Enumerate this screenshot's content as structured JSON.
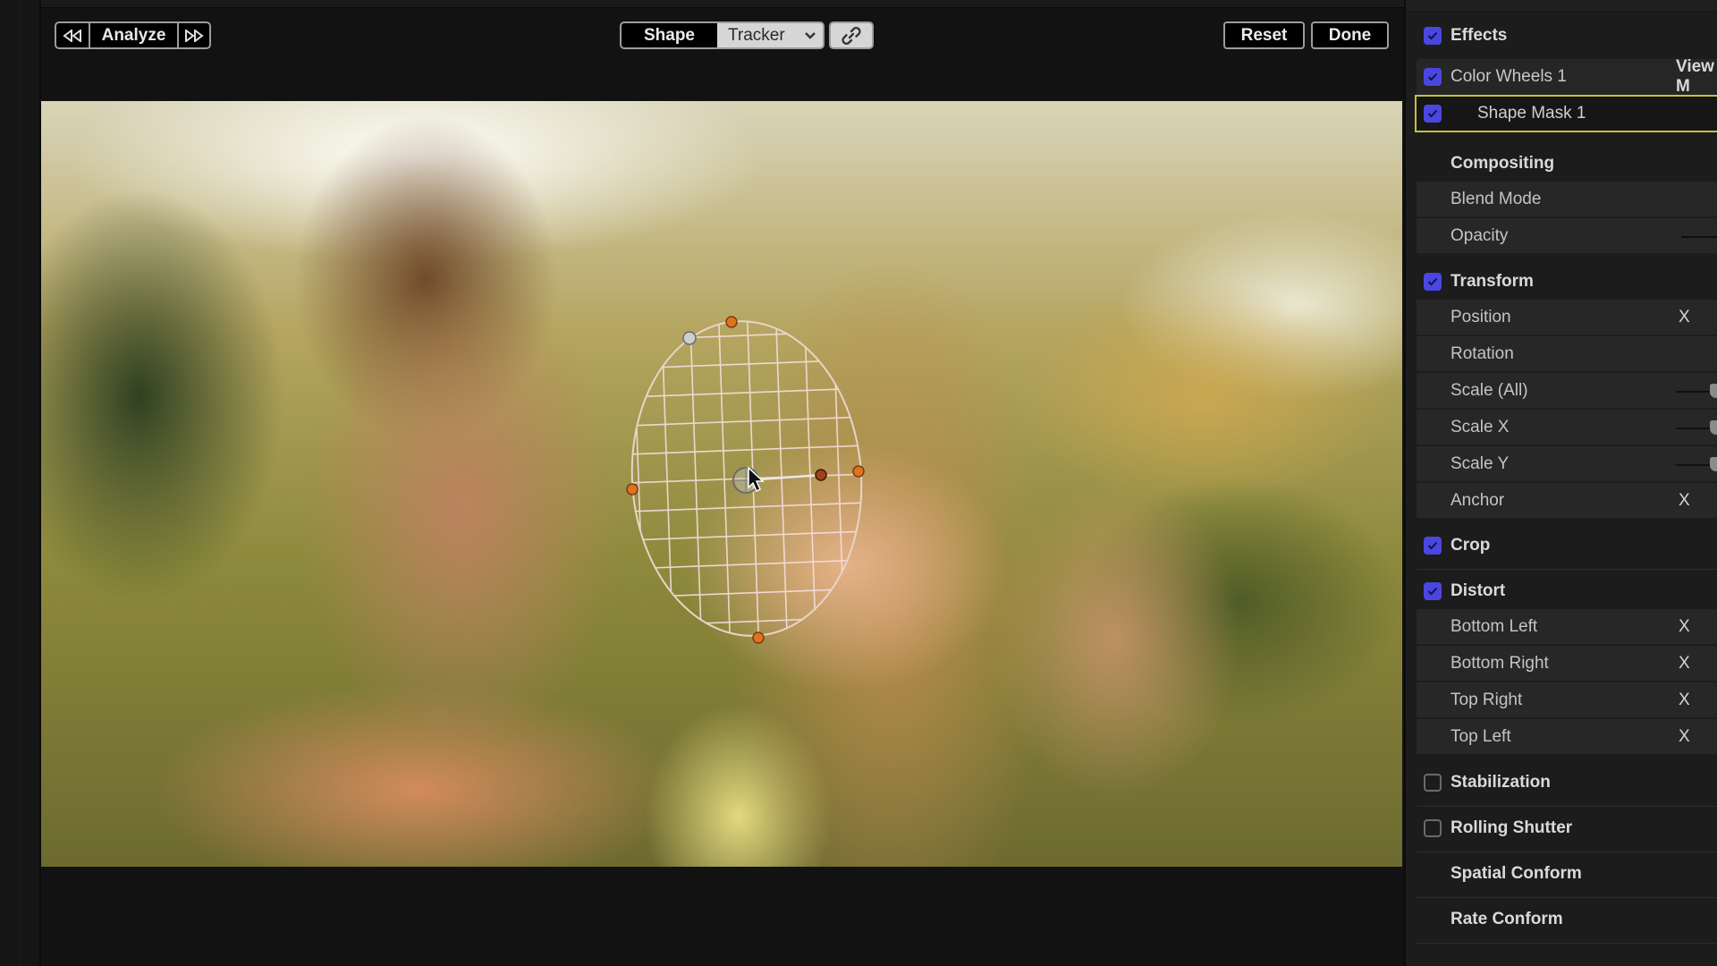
{
  "viewer": {
    "toolbar": {
      "prev_icon": "rewind-icon",
      "analyze_label": "Analyze",
      "next_icon": "fast-forward-icon",
      "shape_label": "Shape",
      "tracker_label": "Tracker",
      "tracker_chevron_icon": "chevron-down-icon",
      "link_icon": "link-icon",
      "reset_label": "Reset",
      "done_label": "Done"
    },
    "image_description": "Couple smiling outdoors in sunlight; shape mask ellipse with grid over woman's face",
    "mask": {
      "shape": "ellipse",
      "handles": [
        "top",
        "left",
        "right",
        "bottom",
        "roundness",
        "rotation",
        "center"
      ],
      "handle_color": "#e0731f",
      "grid_color": "#f4d9d9"
    }
  },
  "inspector": {
    "effects": {
      "label": "Effects",
      "checked": true
    },
    "color_wheels": {
      "label": "Color Wheels 1",
      "checked": true,
      "view_label": "View M"
    },
    "shape_mask": {
      "label": "Shape Mask 1",
      "checked": true,
      "highlight_color": "#c6c33a"
    },
    "compositing": {
      "label": "Compositing",
      "items": [
        {
          "label": "Blend Mode"
        },
        {
          "label": "Opacity"
        }
      ]
    },
    "transform": {
      "label": "Transform",
      "checked": true,
      "items": [
        {
          "label": "Position",
          "value": "X"
        },
        {
          "label": "Rotation"
        },
        {
          "label": "Scale (All)"
        },
        {
          "label": "Scale X"
        },
        {
          "label": "Scale Y"
        },
        {
          "label": "Anchor",
          "value": "X"
        }
      ]
    },
    "crop": {
      "label": "Crop",
      "checked": true
    },
    "distort": {
      "label": "Distort",
      "checked": true,
      "items": [
        {
          "label": "Bottom Left",
          "value": "X"
        },
        {
          "label": "Bottom Right",
          "value": "X"
        },
        {
          "label": "Top Right",
          "value": "X"
        },
        {
          "label": "Top Left",
          "value": "X"
        }
      ]
    },
    "stabilization": {
      "label": "Stabilization",
      "checked": false
    },
    "rolling_shutter": {
      "label": "Rolling Shutter",
      "checked": false
    },
    "spatial_conform": {
      "label": "Spatial Conform"
    },
    "rate_conform": {
      "label": "Rate Conform"
    },
    "checkbox_color": "#4a47e0"
  }
}
